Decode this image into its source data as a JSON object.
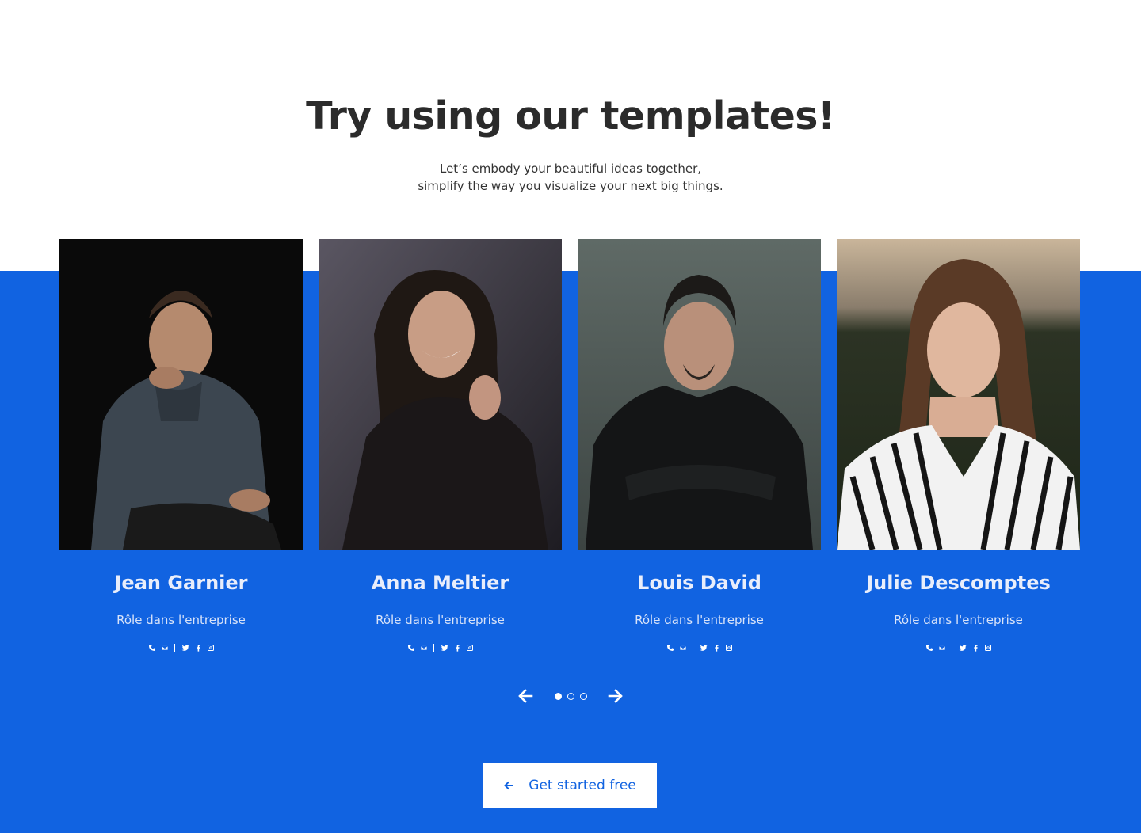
{
  "header": {
    "title": "Try using our templates!",
    "subtitle_line1": "Let’s embody your beautiful ideas together,",
    "subtitle_line2": "simplify the way you visualize your next big things."
  },
  "team": [
    {
      "name": "Jean Garnier",
      "role": "Rôle dans l'entreprise"
    },
    {
      "name": "Anna Meltier",
      "role": "Rôle dans l'entreprise"
    },
    {
      "name": "Louis David",
      "role": "Rôle dans l'entreprise"
    },
    {
      "name": "Julie Descomptes",
      "role": "Rôle dans l'entreprise"
    }
  ],
  "social_icons": [
    "phone-icon",
    "mail-icon",
    "twitter-icon",
    "facebook-icon",
    "instagram-icon"
  ],
  "carousel": {
    "pages": 3,
    "active_page": 1,
    "prev_icon": "arrow-left-icon",
    "next_icon": "arrow-right-icon"
  },
  "cta": {
    "label": "Get started free",
    "icon": "arrow-left-icon"
  },
  "colors": {
    "brand_blue": "#1163e1",
    "heading": "#2b2b2b",
    "white": "#ffffff"
  }
}
